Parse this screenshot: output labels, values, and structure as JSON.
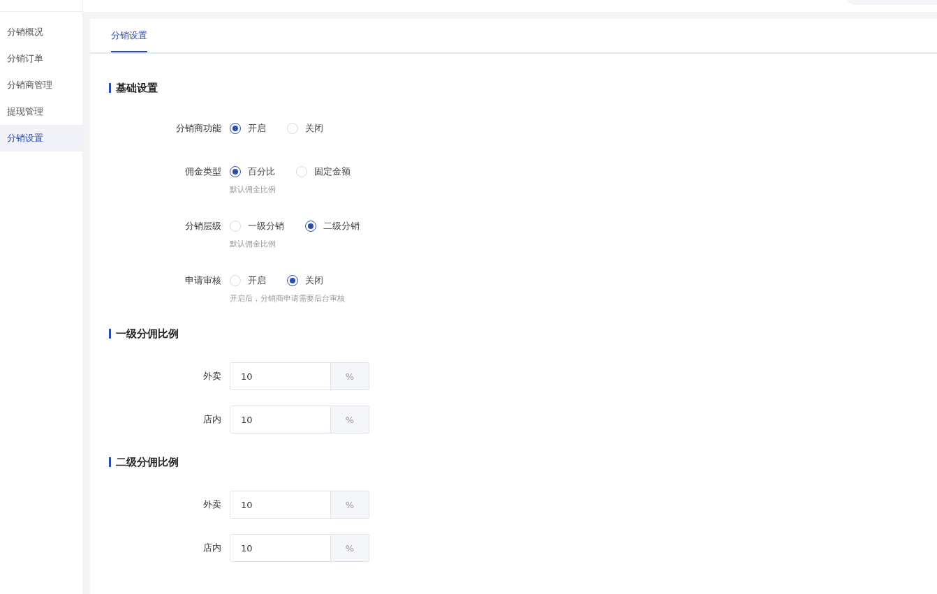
{
  "sidebar": {
    "items": [
      {
        "label": "分销概况",
        "selected": false
      },
      {
        "label": "分销订单",
        "selected": false
      },
      {
        "label": "分销商管理",
        "selected": false
      },
      {
        "label": "提现管理",
        "selected": false
      },
      {
        "label": "分销设置",
        "selected": true
      }
    ]
  },
  "tabs": [
    {
      "label": "分销设置",
      "selected": true
    }
  ],
  "sections": [
    {
      "title": "基础设置",
      "fields": [
        {
          "kind": "radio",
          "label": "分销商功能",
          "options": [
            {
              "label": "开启",
              "selected": true
            },
            {
              "label": "关闭",
              "selected": false
            }
          ]
        },
        {
          "kind": "radio",
          "label": "佣金类型",
          "options": [
            {
              "label": "百分比",
              "selected": true
            },
            {
              "label": "固定金额",
              "selected": false
            }
          ],
          "hint": "默认佣金比例"
        },
        {
          "kind": "radio",
          "label": "分销层级",
          "options": [
            {
              "label": "一级分销",
              "selected": false
            },
            {
              "label": "二级分销",
              "selected": true
            }
          ],
          "hint": "默认佣金比例"
        },
        {
          "kind": "radio",
          "label": "申请审核",
          "options": [
            {
              "label": "开启",
              "selected": false
            },
            {
              "label": "关闭",
              "selected": true
            }
          ],
          "hint": "开启后，分销商申请需要后台审核"
        }
      ]
    },
    {
      "title": "一级分佣比例",
      "fields": [
        {
          "kind": "input",
          "label": "外卖",
          "value": "10",
          "suffix": "%"
        },
        {
          "kind": "input",
          "label": "店内",
          "value": "10",
          "suffix": "%"
        }
      ]
    },
    {
      "title": "二级分佣比例",
      "fields": [
        {
          "kind": "input",
          "label": "外卖",
          "value": "10",
          "suffix": "%"
        },
        {
          "kind": "input",
          "label": "店内",
          "value": "10",
          "suffix": "%"
        }
      ]
    }
  ]
}
